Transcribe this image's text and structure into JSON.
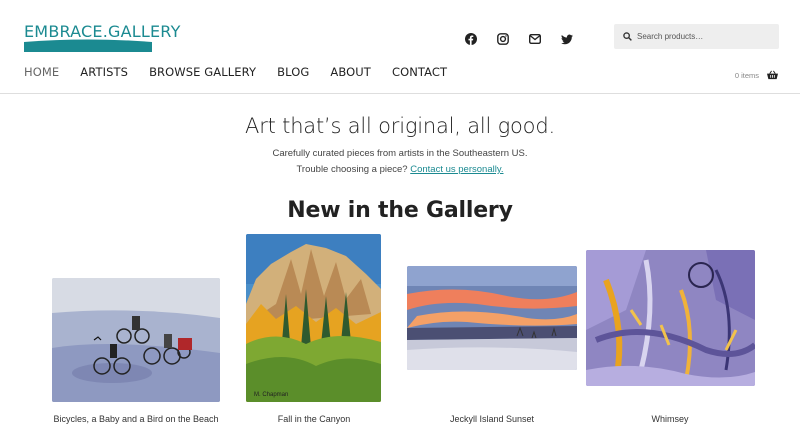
{
  "logo": {
    "text": "EMBRACE.GALLERY"
  },
  "social": [
    "facebook-icon",
    "instagram-icon",
    "email-icon",
    "twitter-icon"
  ],
  "search": {
    "placeholder": "Search products…"
  },
  "nav": [
    "HOME",
    "ARTISTS",
    "BROWSE GALLERY",
    "BLOG",
    "ABOUT",
    "CONTACT"
  ],
  "cart": {
    "count_label": "0 items"
  },
  "hero": {
    "title": "Art that’s all original, all good.",
    "line1": "Carefully curated pieces from artists in the Southeastern US.",
    "line2_prefix": "Trouble choosing a piece? ",
    "line2_link": "Contact us personally."
  },
  "section_title": "New in the Gallery",
  "products": [
    {
      "name": "Bicycles, a Baby and a Bird on the Beach"
    },
    {
      "name": "Fall in the Canyon"
    },
    {
      "name": "Jeckyll Island Sunset"
    },
    {
      "name": "Whimsey"
    }
  ],
  "colors": {
    "accent": "#1b8a91"
  }
}
